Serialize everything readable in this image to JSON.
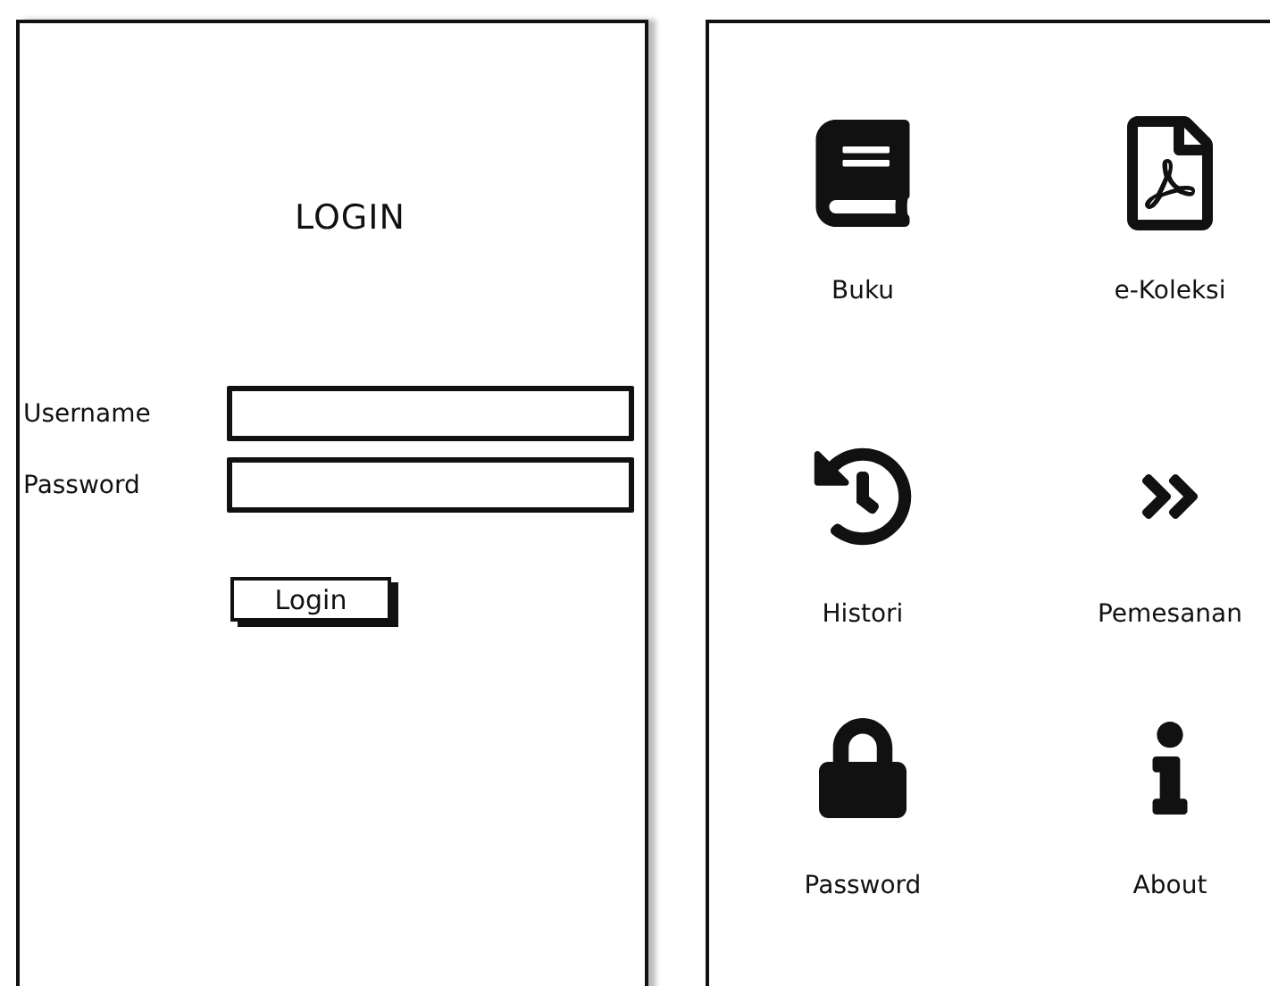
{
  "login_screen": {
    "title": "LOGIN",
    "fields": [
      {
        "label": "Username"
      },
      {
        "label": "Password"
      }
    ],
    "button": "Login"
  },
  "menu_screen": {
    "items": [
      {
        "label": "Buku",
        "kind": "book"
      },
      {
        "label": "e-Koleksi",
        "kind": "pdf"
      },
      {
        "label": "Histori",
        "kind": "history"
      },
      {
        "label": "Pemesanan",
        "kind": "chevrons"
      },
      {
        "label": "Password",
        "kind": "lock"
      },
      {
        "label": "About",
        "kind": "info"
      }
    ]
  }
}
